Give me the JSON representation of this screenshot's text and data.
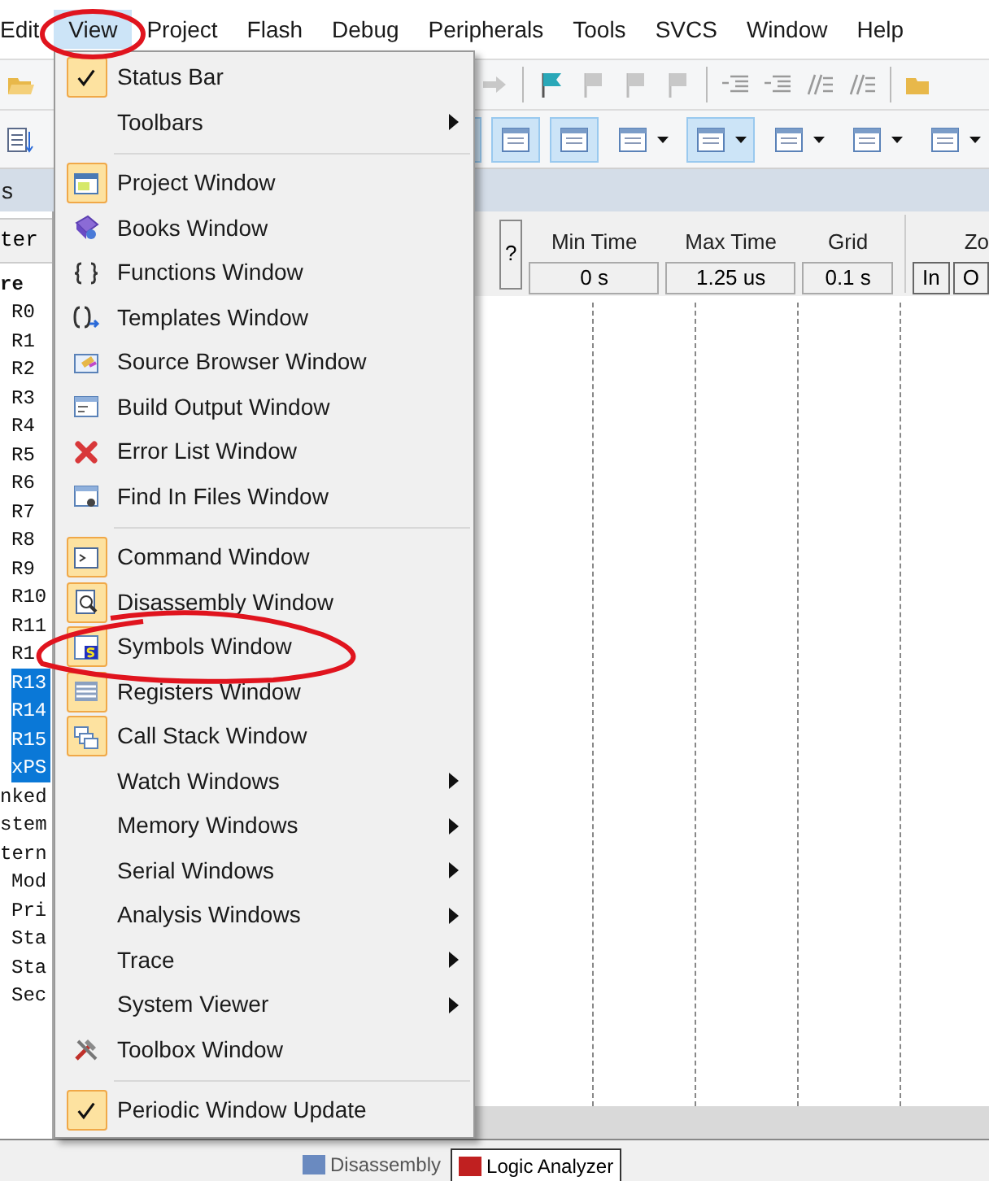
{
  "menubar": [
    {
      "label": "Edit",
      "selected": false
    },
    {
      "label": "View",
      "selected": true
    },
    {
      "label": "Project",
      "selected": false
    },
    {
      "label": "Flash",
      "selected": false
    },
    {
      "label": "Debug",
      "selected": false
    },
    {
      "label": "Peripherals",
      "selected": false
    },
    {
      "label": "Tools",
      "selected": false
    },
    {
      "label": "SVCS",
      "selected": false
    },
    {
      "label": "Window",
      "selected": false
    },
    {
      "label": "Help",
      "selected": false
    }
  ],
  "toolbar_2": [
    {
      "pressed": true,
      "dropdown": false
    },
    {
      "pressed": true,
      "dropdown": false
    },
    {
      "pressed": true,
      "dropdown": false
    },
    {
      "pressed": false,
      "dropdown": true
    },
    {
      "pressed": true,
      "dropdown": true
    },
    {
      "pressed": false,
      "dropdown": true
    },
    {
      "pressed": false,
      "dropdown": true
    },
    {
      "pressed": false,
      "dropdown": true
    }
  ],
  "left_pane": {
    "title": "s",
    "column_header": "ter",
    "tree": [
      {
        "label": "re",
        "bold": true,
        "selected": false,
        "children": [
          {
            "label": "R0",
            "selected": false
          },
          {
            "label": "R1",
            "selected": false
          },
          {
            "label": "R2",
            "selected": false
          },
          {
            "label": "R3",
            "selected": false
          },
          {
            "label": "R4",
            "selected": false
          },
          {
            "label": "R5",
            "selected": false
          },
          {
            "label": "R6",
            "selected": false
          },
          {
            "label": "R7",
            "selected": false
          },
          {
            "label": "R8",
            "selected": false
          },
          {
            "label": "R9",
            "selected": false
          },
          {
            "label": "R10",
            "selected": false
          },
          {
            "label": "R11",
            "selected": false
          },
          {
            "label": "R1",
            "selected": false
          },
          {
            "label": "R13",
            "selected": true
          },
          {
            "label": "R14",
            "selected": true
          },
          {
            "label": "R15",
            "selected": true
          },
          {
            "label": "xPS",
            "selected": true
          }
        ]
      },
      {
        "label": "nked",
        "bold": false,
        "selected": false
      },
      {
        "label": "stem",
        "bold": false,
        "selected": false
      },
      {
        "label": "tern",
        "bold": false,
        "selected": false,
        "children": [
          {
            "label": "Mod",
            "selected": false
          },
          {
            "label": "Pri",
            "selected": false
          },
          {
            "label": "Sta",
            "selected": false
          },
          {
            "label": "Sta",
            "selected": false
          },
          {
            "label": "Sec",
            "selected": false
          }
        ]
      }
    ]
  },
  "view_menu": {
    "items": [
      {
        "kind": "check",
        "label": "Status Bar",
        "checked": true
      },
      {
        "kind": "submenu",
        "label": "Toolbars"
      },
      {
        "kind": "separator"
      },
      {
        "kind": "item",
        "label": "Project Window",
        "checked": true
      },
      {
        "kind": "item",
        "label": "Books Window",
        "checked": false
      },
      {
        "kind": "item",
        "label": "Functions Window",
        "checked": false
      },
      {
        "kind": "item",
        "label": "Templates Window",
        "checked": false
      },
      {
        "kind": "item",
        "label": "Source Browser Window",
        "checked": false
      },
      {
        "kind": "item",
        "label": "Build Output Window",
        "checked": false
      },
      {
        "kind": "item",
        "label": "Error List Window",
        "checked": false
      },
      {
        "kind": "item",
        "label": "Find In Files Window",
        "checked": false
      },
      {
        "kind": "separator"
      },
      {
        "kind": "item",
        "label": "Command Window",
        "checked": true
      },
      {
        "kind": "item",
        "label": "Disassembly Window",
        "checked": true
      },
      {
        "kind": "item",
        "label": "Symbols Window",
        "checked": true
      },
      {
        "kind": "item",
        "label": "Registers Window",
        "checked": true
      },
      {
        "kind": "item",
        "label": "Call Stack Window",
        "checked": true
      },
      {
        "kind": "submenu",
        "label": "Watch Windows"
      },
      {
        "kind": "submenu",
        "label": "Memory Windows"
      },
      {
        "kind": "submenu",
        "label": "Serial Windows"
      },
      {
        "kind": "submenu",
        "label": "Analysis Windows"
      },
      {
        "kind": "submenu",
        "label": "Trace"
      },
      {
        "kind": "submenu",
        "label": "System Viewer"
      },
      {
        "kind": "item",
        "label": "Toolbox Window",
        "checked": false
      },
      {
        "kind": "separator"
      },
      {
        "kind": "check",
        "label": "Periodic Window Update",
        "checked": true
      }
    ]
  },
  "logic_analyzer": {
    "help_button": "?",
    "fields": [
      {
        "label": "Min Time",
        "value": "0 s"
      },
      {
        "label": "Max Time",
        "value": "1.25 us"
      },
      {
        "label": "Grid",
        "value": "0.1 s"
      }
    ],
    "zoom_label": "Zo",
    "zoom_buttons": [
      "In",
      "O"
    ]
  },
  "bottom_tabs": [
    {
      "label": "Disassembly",
      "selected": false
    },
    {
      "label": "Logic Analyzer",
      "selected": true
    }
  ]
}
